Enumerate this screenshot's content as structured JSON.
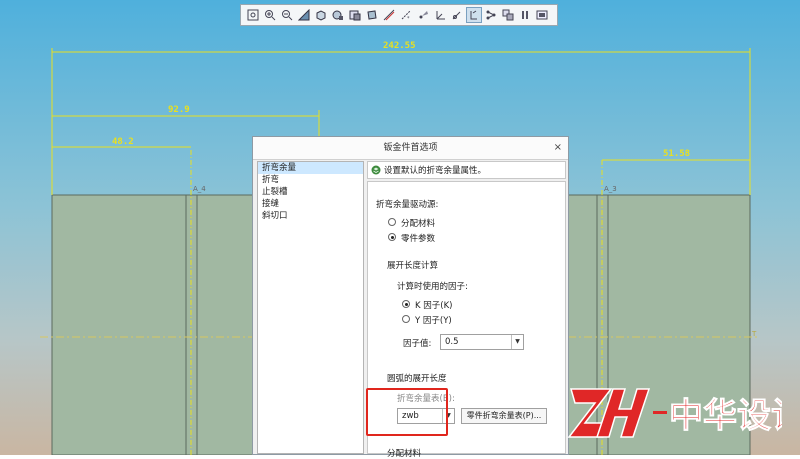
{
  "toolbar": {
    "icons": [
      "zoom-fit-icon",
      "zoom-in-icon",
      "zoom-out-icon",
      "view-plane-icon",
      "cube-view-icon",
      "saved-view-icon",
      "display-style-icon",
      "shade-icon",
      "datum-plane-icon",
      "datum-axis-icon",
      "datum-point-icon",
      "csys-icon",
      "sketch-icon",
      "annotation-icon",
      "spin-center-icon",
      "appearance-icon",
      "pause-icon",
      "repaint-icon"
    ],
    "active_index": 13
  },
  "drawing": {
    "dim_total": "242.55",
    "dim_mid": "92.9",
    "dim_left": "48.2",
    "dim_right": "51.58",
    "colors": {
      "dimension": "#e8e020",
      "part": "#a1b8a2",
      "centerline": "#d8c860"
    }
  },
  "dialog": {
    "title": "钣金件首选项",
    "close": "×",
    "nav_items": [
      "折弯余量",
      "折弯",
      "止裂槽",
      "接缝",
      "斜切口"
    ],
    "selected_nav": 0,
    "header_text": "设置默认的折弯余量属性。",
    "drive_label": "折弯余量驱动源:",
    "drive_options": [
      "分配材料",
      "零件参数"
    ],
    "drive_selected": 1,
    "unfold_label": "展开长度计算",
    "factor_label": "计算时使用的因子:",
    "factor_options": [
      "K 因子(K)",
      "Y 因子(Y)"
    ],
    "factor_selected": 0,
    "factor_value_label": "因子值:",
    "factor_value": "0.5",
    "arc_label": "圆弧的展开长度",
    "table_label": "折弯余量表(B):",
    "table_value": "zwb",
    "table_button": "零件折弯余量表(P)...",
    "assign_label": "分配材料"
  },
  "watermark": {
    "text": "中华设计"
  }
}
